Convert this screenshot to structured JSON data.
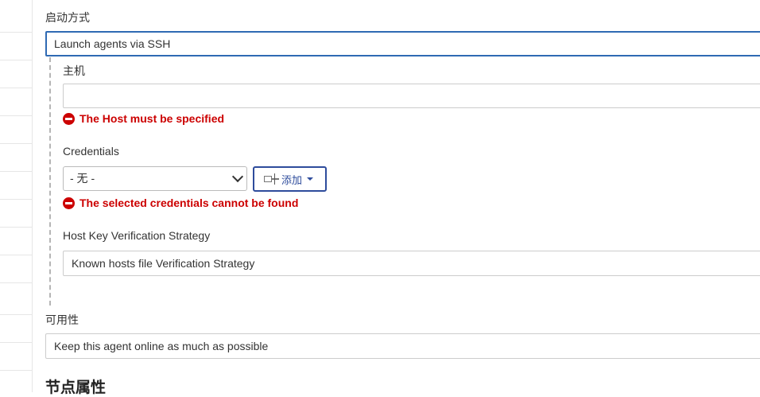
{
  "launch": {
    "label": "启动方式",
    "value": "Launch agents via SSH"
  },
  "host": {
    "label": "主机",
    "value": "",
    "error": "The Host must be specified"
  },
  "credentials": {
    "label": "Credentials",
    "selected": "- 无 -",
    "add_label": "添加",
    "error": "The selected credentials cannot be found"
  },
  "host_key": {
    "label": "Host Key Verification Strategy",
    "value": "Known hosts file Verification Strategy"
  },
  "availability": {
    "label": "可用性",
    "value": "Keep this agent online as much as possible"
  },
  "node_properties": {
    "heading": "节点属性"
  },
  "colors": {
    "error": "#cc0000",
    "accent": "#2e4c9c",
    "focus": "#2f6ab3"
  }
}
